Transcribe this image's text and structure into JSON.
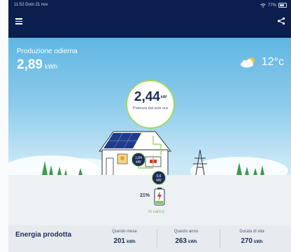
{
  "status": {
    "time": "11:52",
    "date": "Dom 21 nov",
    "battery": "77%"
  },
  "header": {
    "menu_icon": "menu-icon",
    "share_icon": "share-icon"
  },
  "production": {
    "label": "Produzione odierna",
    "value": "2,89",
    "unit": "kWh"
  },
  "weather": {
    "icon": "partly-cloudy-icon",
    "temperature": "12°c"
  },
  "flow": {
    "solar_power": "2,44",
    "solar_unit": "kW",
    "solar_caption": "Potenza dal sole ora",
    "house_power": "1,84",
    "house_unit": "kW",
    "battery_power": "0,6",
    "battery_unit": "kW",
    "battery_soc": "21%",
    "battery_status": "In carica"
  },
  "energy": {
    "title": "Energia prodotta",
    "stats": [
      {
        "label": "Questo mese",
        "value": "201",
        "unit": "kWh"
      },
      {
        "label": "Questo anno",
        "value": "263",
        "unit": "kWh"
      },
      {
        "label": "Durata di vita",
        "value": "270",
        "unit": "kWh"
      }
    ]
  },
  "colors": {
    "header_bg": "#0b1f4e",
    "accent_green": "#9fd66a",
    "node_bg": "#1b2c58"
  }
}
